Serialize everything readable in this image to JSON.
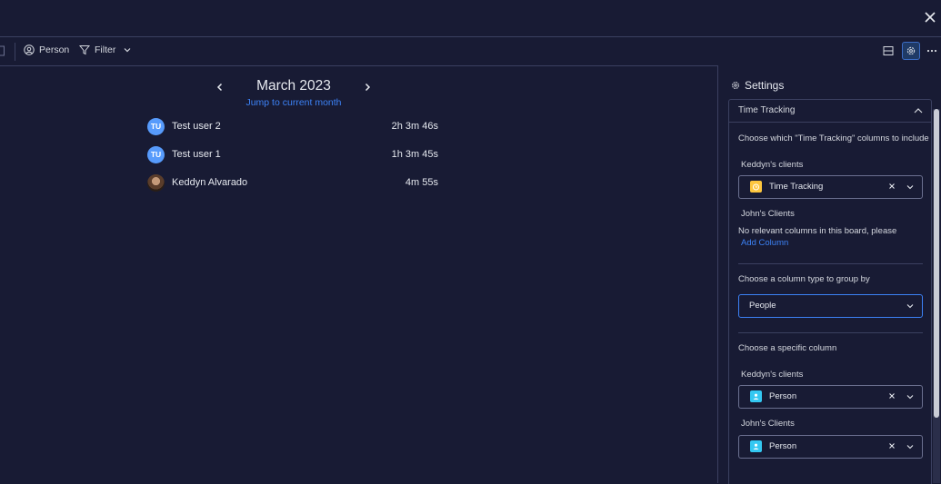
{
  "toolbar": {
    "person_label": "Person",
    "filter_label": "Filter"
  },
  "calendar": {
    "month_title": "March 2023",
    "jump_label": "Jump to current month"
  },
  "users": [
    {
      "initials": "TU",
      "name": "Test user 2",
      "time": "2h 3m 46s"
    },
    {
      "initials": "TU",
      "name": "Test user 1",
      "time": "1h 3m 45s"
    },
    {
      "initials": "",
      "name": "Keddyn Alvarado",
      "time": "4m 55s"
    }
  ],
  "settings": {
    "title": "Settings",
    "section_title": "Time Tracking",
    "choose_columns_text": "Choose which \"Time Tracking\" columns to include",
    "board1_name": "Keddyn's clients",
    "board1_column_value": "Time Tracking",
    "board2_name": "John's Clients",
    "no_columns_text": "No relevant columns in this board, please",
    "add_column_label": "Add Column",
    "group_by_label": "Choose a column type to group by",
    "group_by_value": "People",
    "specific_column_label": "Choose a specific column",
    "board1_person_name": "Keddyn's clients",
    "board1_person_value": "Person",
    "board2_person_name": "John's Clients",
    "board2_person_value": "Person"
  },
  "colors": {
    "background": "#181b34",
    "accent": "#3c82f6",
    "avatar_blue": "#579bfc",
    "time_tracking_icon": "#fdc63e",
    "person_icon": "#34c8f2"
  }
}
